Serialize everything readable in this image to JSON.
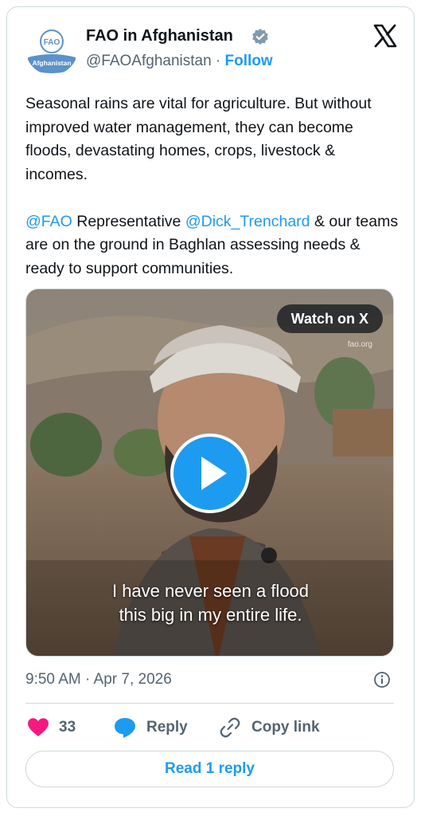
{
  "author": {
    "display_name": "FAO in Afghanistan",
    "handle": "@FAOAfghanistan",
    "separator": " · ",
    "follow_label": "Follow",
    "avatar_text": "Afghanistan",
    "verified_icon": "verified-badge-icon"
  },
  "tweet": {
    "paragraph1": "Seasonal rains are vital for agriculture. But without improved water management, they can become floods, devastating homes, crops, livestock & incomes.",
    "mention1": "@FAO",
    "text_a": " Representative ",
    "mention2": "@Dick_Trenchard",
    "text_b": " & our teams are on the ground in Baghlan assessing needs & ready to support communities."
  },
  "media": {
    "watch_label": "Watch on X",
    "watermark": "fao.org",
    "subtitle_line1": "I have never seen a flood",
    "subtitle_line2": "this big in my entire life."
  },
  "timestamp": "9:50 AM · Apr 7, 2026",
  "actions": {
    "like_count": "33",
    "reply_label": "Reply",
    "copy_label": "Copy link"
  },
  "read_reply_label": "Read 1 reply",
  "colors": {
    "accent": "#1d9bf0",
    "like": "#f91880",
    "muted": "#536471",
    "text": "#0f1419",
    "border": "#cfd9de"
  }
}
